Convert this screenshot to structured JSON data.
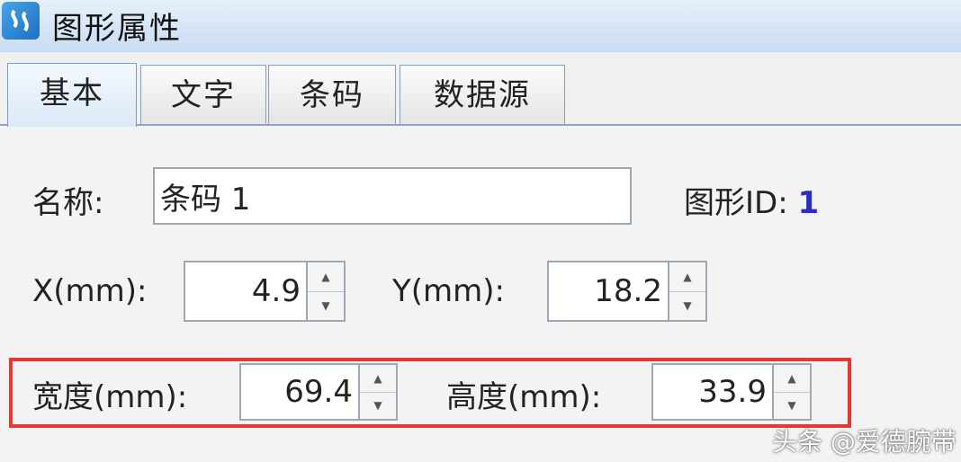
{
  "window": {
    "title": "图形属性"
  },
  "tabs": [
    {
      "label": "基本",
      "active": true
    },
    {
      "label": "文字",
      "active": false
    },
    {
      "label": "条码",
      "active": false
    },
    {
      "label": "数据源",
      "active": false
    }
  ],
  "basic": {
    "name_label": "名称:",
    "name_value": "条码 1",
    "shape_id_label": "图形ID:",
    "shape_id_value": "1",
    "x_label": "X(mm):",
    "x_value": "4.9",
    "y_label": "Y(mm):",
    "y_value": "18.2",
    "width_label": "宽度(mm):",
    "width_value": "69.4",
    "height_label": "高度(mm):",
    "height_value": "33.9"
  },
  "watermark": "头条 @爱德腕带",
  "colors": {
    "highlight": "#e53935",
    "id_value": "#2b2bc8"
  }
}
